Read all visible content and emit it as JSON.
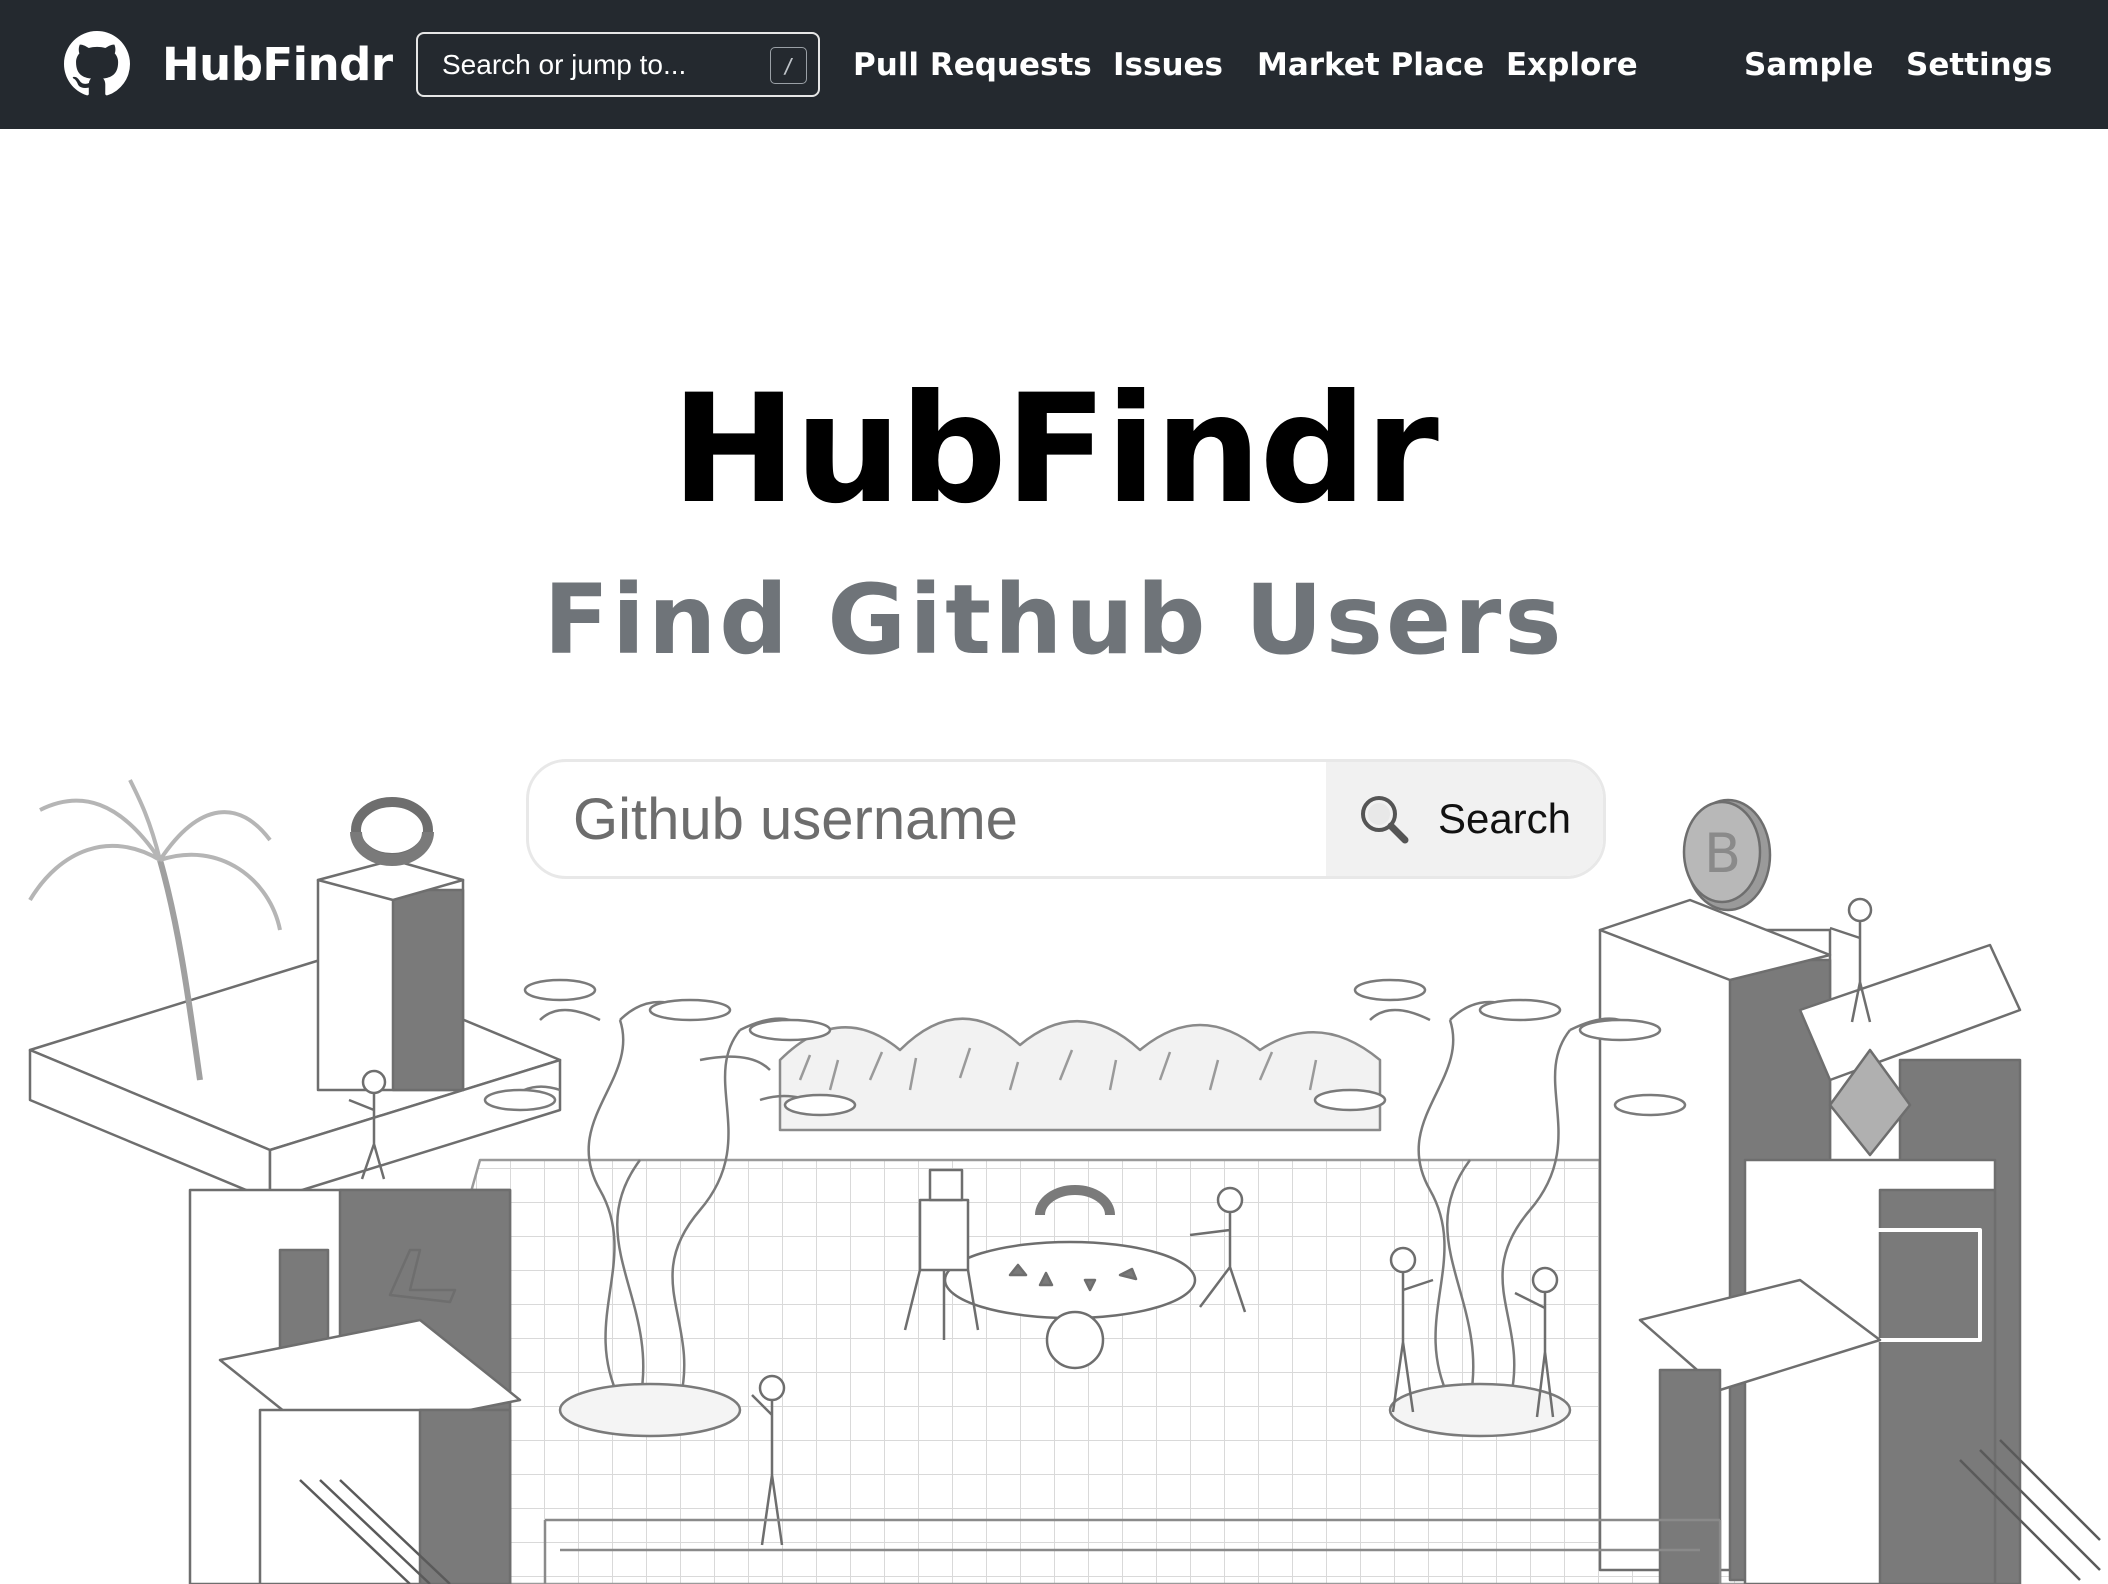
{
  "nav": {
    "brand": "HubFindr",
    "search_placeholder": "Search or jump to...",
    "shortcut_key": "/",
    "links": {
      "pull_requests": "Pull Requests",
      "issues": "Issues",
      "market_place": "Market Place",
      "explore": "Explore",
      "sample": "Sample",
      "settings": "Settings"
    }
  },
  "hero": {
    "title": "HubFindr",
    "subtitle": "Find Github Users"
  },
  "search": {
    "placeholder": "Github username",
    "button_label": "Search",
    "button_icon": "magnifier-icon"
  },
  "colors": {
    "nav_bg": "#24292f",
    "subtitle": "#6f7479",
    "button_bg": "#f1f1f1",
    "illustration_stroke": "#6e6e6e",
    "illustration_fill": "#7a7a7a"
  }
}
